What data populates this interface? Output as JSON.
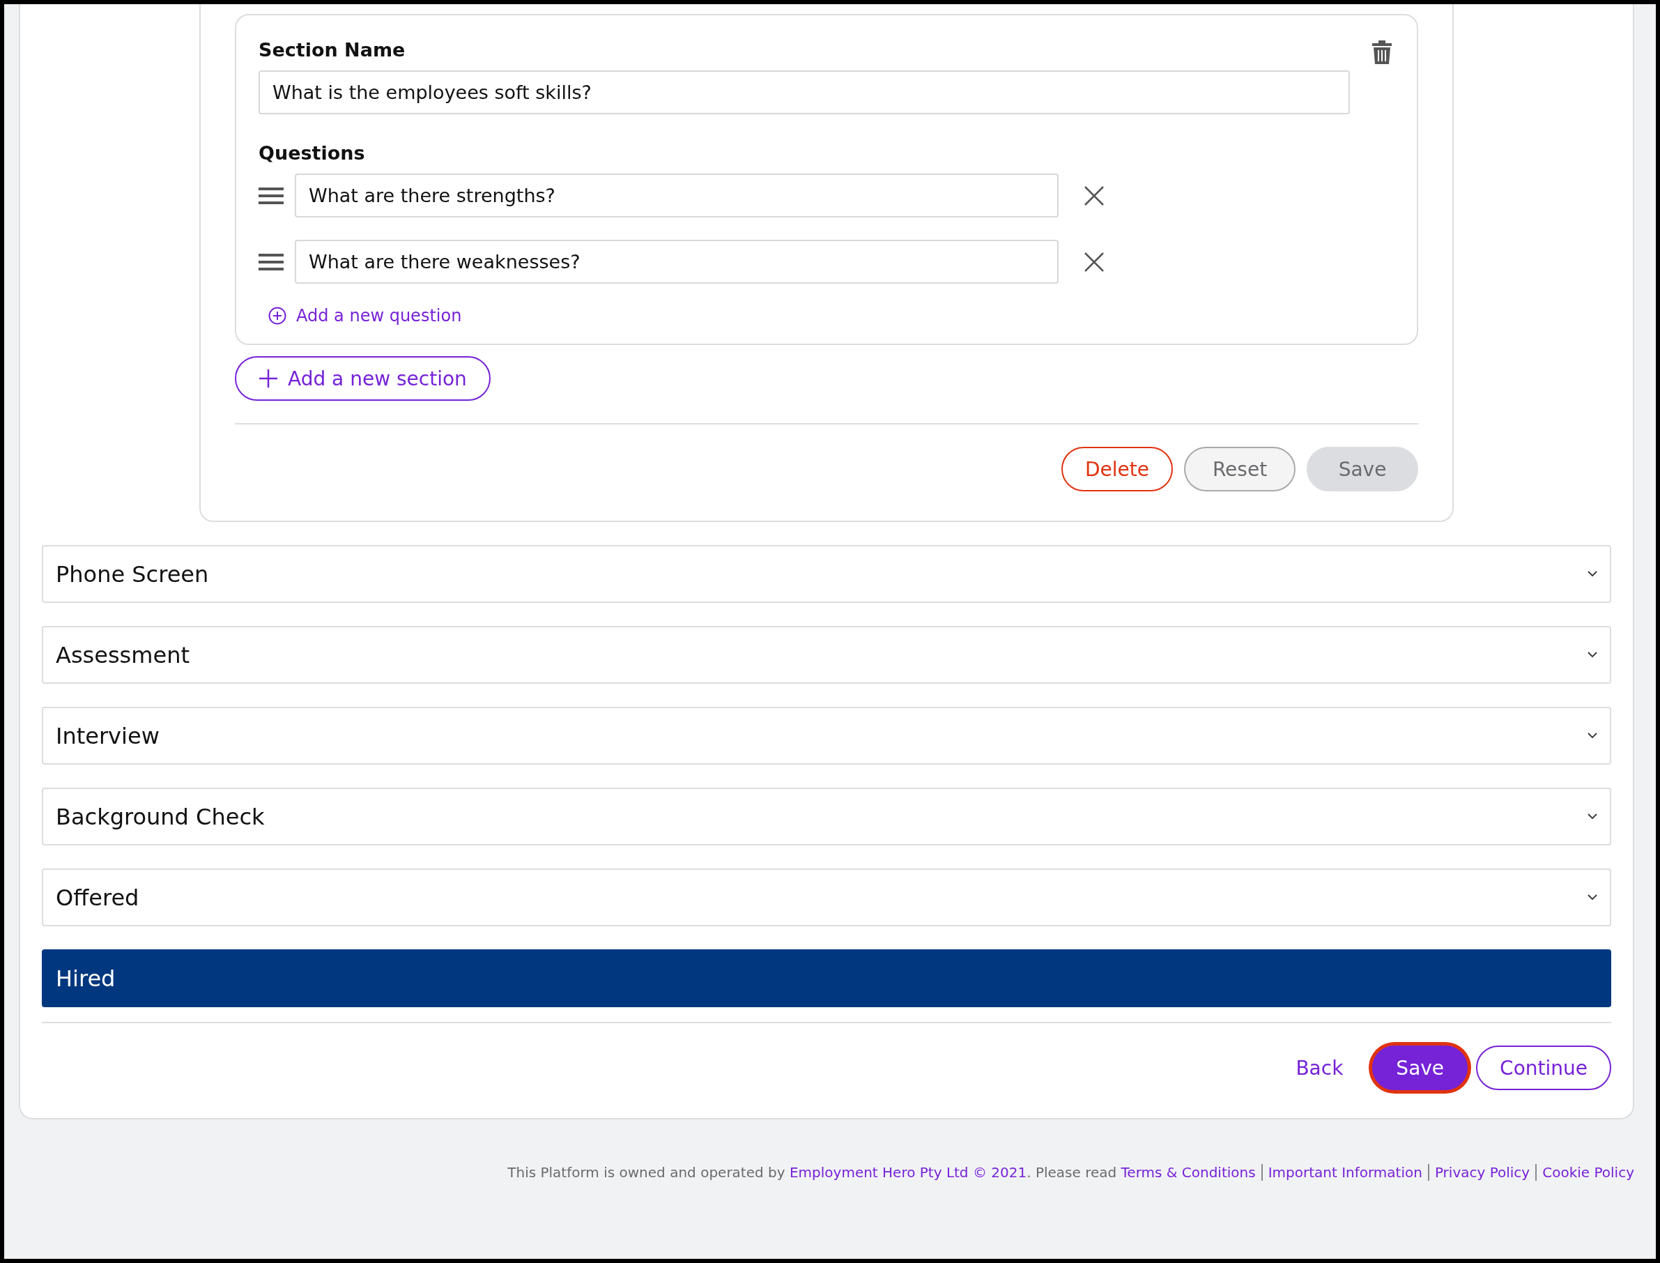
{
  "section": {
    "label": "Section Name",
    "name_value": "What is the employees soft skills?",
    "questions_label": "Questions",
    "questions": [
      "What are there strengths?",
      "What are there weaknesses?"
    ],
    "add_question": "Add a new question"
  },
  "add_section": "Add a new section",
  "actions": [
    {
      "label": "Delete",
      "kind": "danger",
      "disabled": false
    },
    {
      "label": "Reset",
      "kind": "neutral",
      "disabled": false
    },
    {
      "label": "Save",
      "kind": "neutral",
      "disabled": true
    }
  ],
  "stages": [
    {
      "label": "Phone Screen",
      "selected": false
    },
    {
      "label": "Assessment",
      "selected": false
    },
    {
      "label": "Interview",
      "selected": false
    },
    {
      "label": "Background Check",
      "selected": false
    },
    {
      "label": "Offered",
      "selected": false
    },
    {
      "label": "Hired",
      "selected": true
    }
  ],
  "nav": [
    {
      "label": "Back",
      "kind": "link",
      "focused": false
    },
    {
      "label": "Save",
      "kind": "primary",
      "focused": true
    },
    {
      "label": "Continue",
      "kind": "outline",
      "focused": false
    }
  ],
  "footer": {
    "text": "This Platform is owned and operated by",
    "owner": "Employment Hero Pty Ltd © 2021",
    "text_after": ". Please read",
    "links": [
      "Terms & Conditions",
      "Important Information",
      "Privacy Policy",
      "Cookie Policy"
    ]
  }
}
